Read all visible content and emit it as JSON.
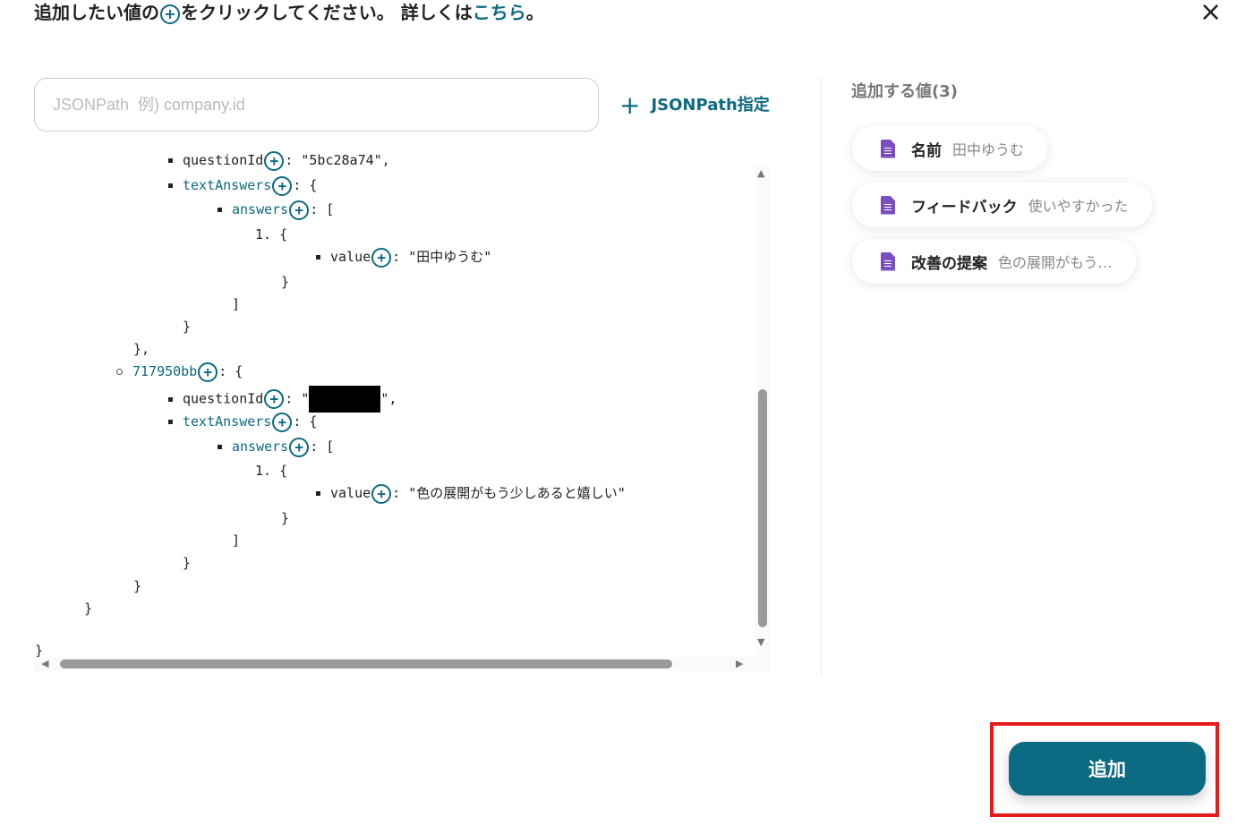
{
  "instruction": {
    "part1": "追加したい値の",
    "plus": "+",
    "part2": "をクリックしてください。 詳しくは",
    "link": "こちら",
    "part3": "。"
  },
  "close_icon": "×",
  "search": {
    "placeholder": "JSONPath  例) company.id",
    "value": ""
  },
  "jsonpath_button": {
    "icon": "+",
    "label": "JSONPath指定"
  },
  "tree": {
    "l0": {
      "key": "questionId",
      "rest": ": \"5bc28a74\","
    },
    "l1": {
      "key": "textAnswers",
      "rest": ": {"
    },
    "l2": {
      "key": "answers",
      "rest": ": ["
    },
    "l3": {
      "text": "1. {"
    },
    "l4": {
      "key": "value",
      "rest": ":  \"田中ゆうむ\""
    },
    "l5": {
      "text": "}"
    },
    "l6": {
      "text": "]"
    },
    "l7": {
      "text": "}"
    },
    "l8": {
      "text": "},"
    },
    "l9": {
      "key": "717950bb",
      "rest": ": {"
    },
    "l10": {
      "key": "questionId",
      "rest_a": ": \"",
      "rest_b": "\","
    },
    "l11": {
      "key": "textAnswers",
      "rest": ": {"
    },
    "l12": {
      "key": "answers",
      "rest": ": ["
    },
    "l13": {
      "text": "1. {"
    },
    "l14": {
      "key": "value",
      "rest": ":  \"色の展開がもう少しあると嬉しい\""
    },
    "l15": {
      "text": "}"
    },
    "l16": {
      "text": "]"
    },
    "l17": {
      "text": "}"
    },
    "l18": {
      "text": "}"
    },
    "l19": {
      "text": "}"
    },
    "l20": {
      "text": "}"
    }
  },
  "right_panel": {
    "title": "追加する値(3)",
    "items": [
      {
        "label": "名前",
        "value": "田中ゆうむ",
        "icon": "google-forms-icon"
      },
      {
        "label": "フィードバック",
        "value": "使いやすかった",
        "icon": "google-forms-icon"
      },
      {
        "label": "改善の提案",
        "value": "色の展開がもう…",
        "icon": "google-forms-icon"
      }
    ]
  },
  "add_button": {
    "label": "追加"
  },
  "colors": {
    "accent": "#0c6a82",
    "highlight": "#e31b1b",
    "form_icon": "#7b4fc0"
  }
}
